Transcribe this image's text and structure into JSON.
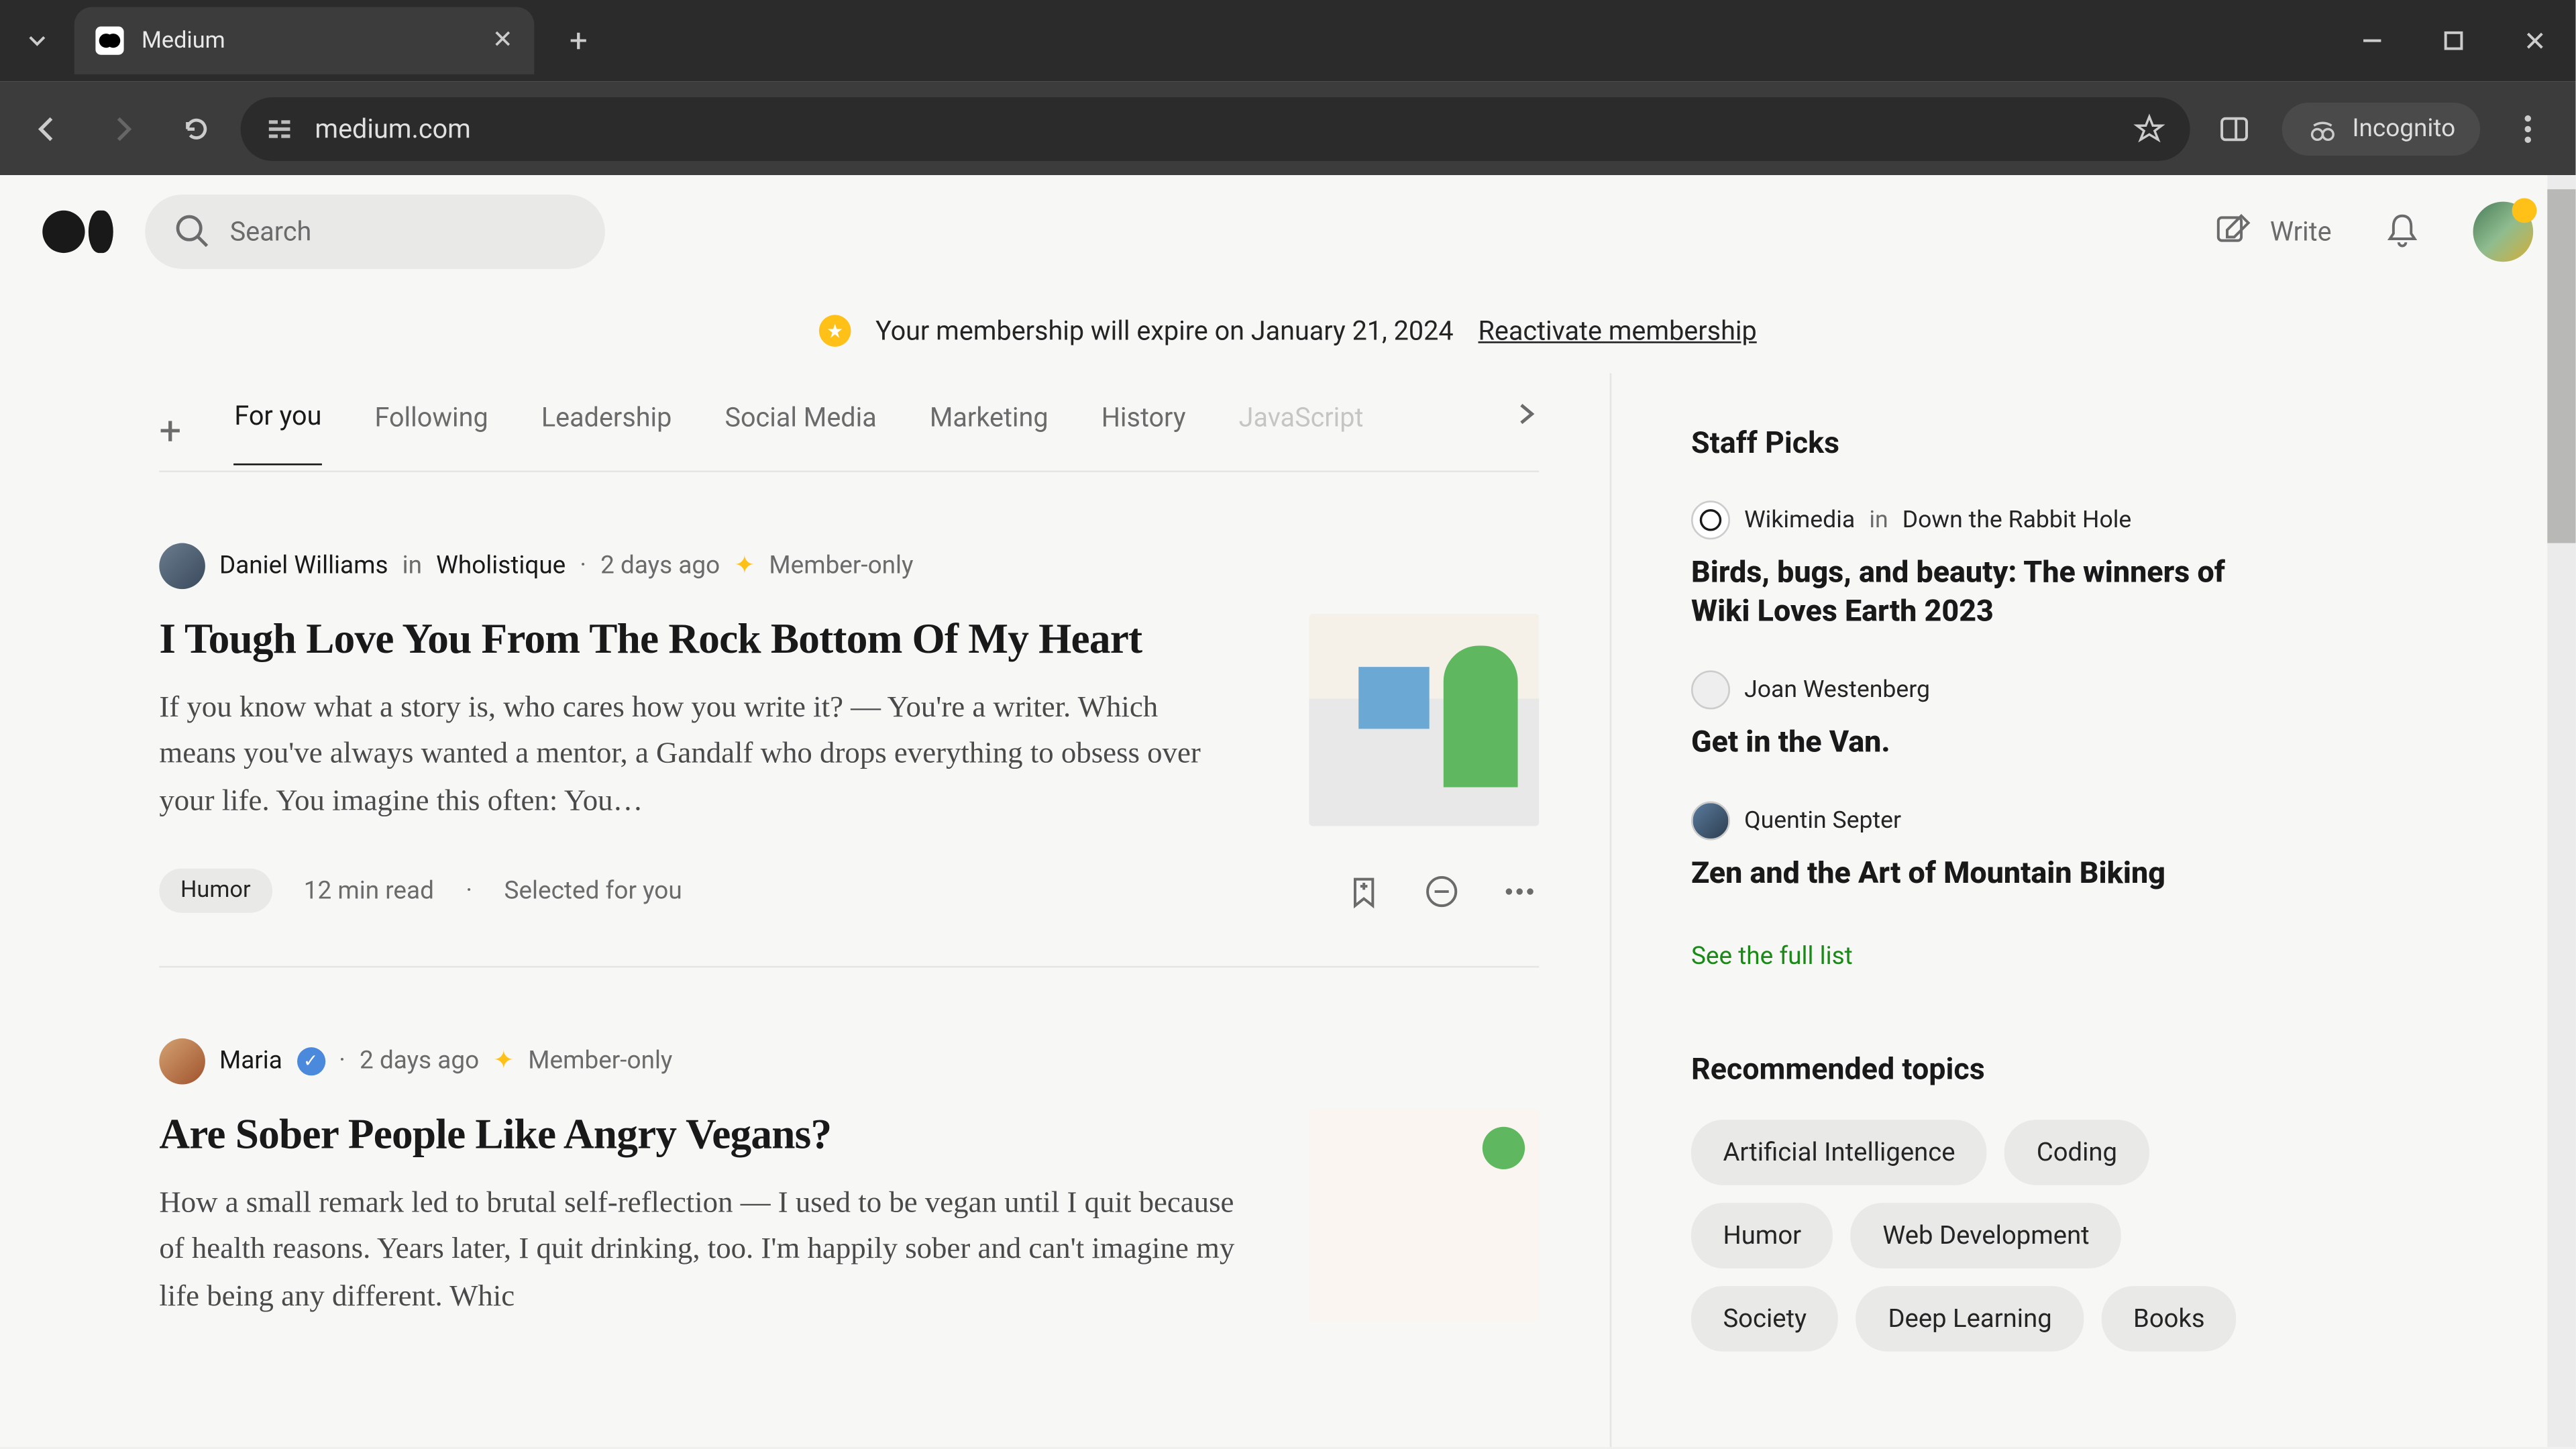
{
  "browser": {
    "tab_title": "Medium",
    "url": "medium.com",
    "incognito_label": "Incognito"
  },
  "header": {
    "search_placeholder": "Search",
    "write_label": "Write"
  },
  "banner": {
    "message": "Your membership will expire on January 21, 2024",
    "cta": "Reactivate membership"
  },
  "tabs": [
    "For you",
    "Following",
    "Leadership",
    "Social Media",
    "Marketing",
    "History",
    "JavaScript"
  ],
  "posts": [
    {
      "author": "Daniel Williams",
      "in_label": "in",
      "publication": "Wholistique",
      "date": "2 days ago",
      "member_label": "Member-only",
      "title": "I Tough Love You From The Rock Bottom Of My Heart",
      "excerpt": "If you know what a story is, who cares how you write it? — You're a writer. Which means you've always wanted a mentor, a Gandalf who drops everything to obsess over your life. You imagine this often: You…",
      "tag": "Humor",
      "read_time": "12 min read",
      "selected": "Selected for you"
    },
    {
      "author": "Maria",
      "verified": true,
      "date": "2 days ago",
      "member_label": "Member-only",
      "title": "Are Sober People Like Angry Vegans?",
      "excerpt": "How a small remark led to brutal self-reflection — I used to be vegan until I quit because of health reasons. Years later, I quit drinking, too. I'm happily sober and can't imagine my life being any different. Whic"
    }
  ],
  "staff_picks": {
    "heading": "Staff Picks",
    "items": [
      {
        "author": "Wikimedia",
        "in_label": "in",
        "publication": "Down the Rabbit Hole",
        "title": "Birds, bugs, and beauty: The winners of Wiki Loves Earth 2023"
      },
      {
        "author": "Joan Westenberg",
        "title": "Get in the Van."
      },
      {
        "author": "Quentin Septer",
        "title": "Zen and the Art of Mountain Biking"
      }
    ],
    "see_all": "See the full list"
  },
  "recommended": {
    "heading": "Recommended topics",
    "topics": [
      "Artificial Intelligence",
      "Coding",
      "Humor",
      "Web Development",
      "Society",
      "Deep Learning",
      "Books"
    ]
  }
}
